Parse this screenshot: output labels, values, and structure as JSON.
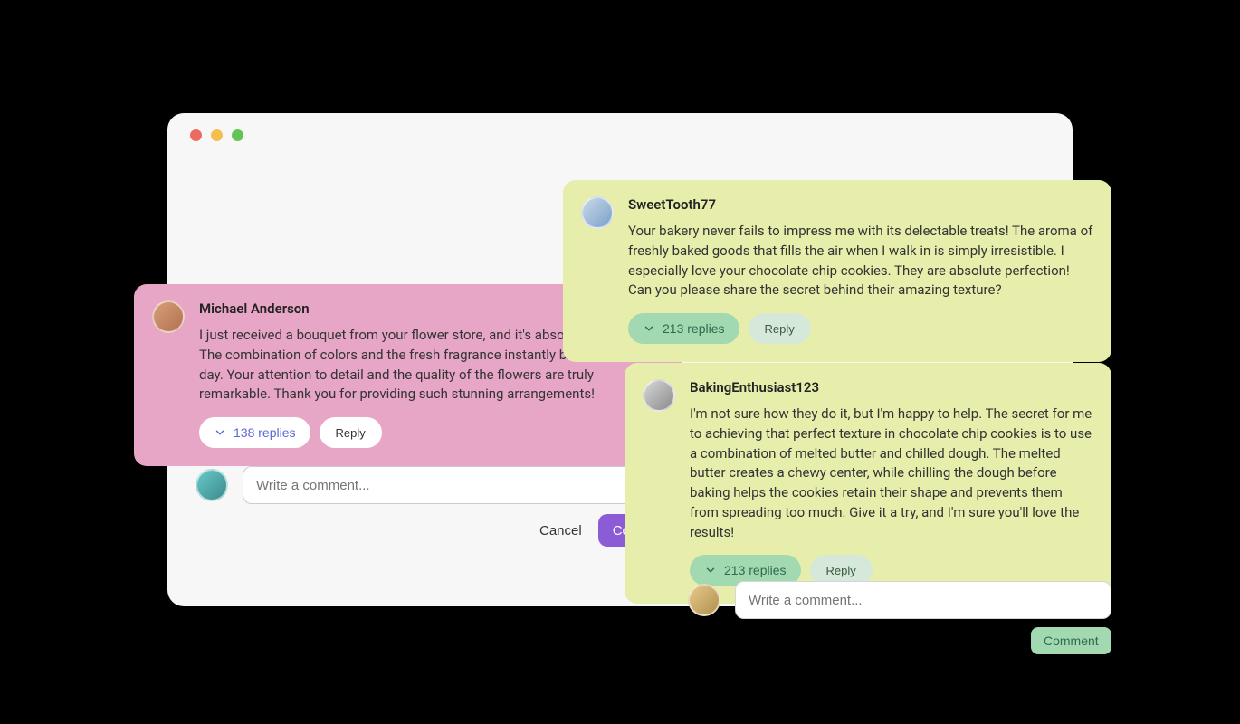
{
  "pink_card": {
    "username": "Michael Anderson",
    "body": "I just received a bouquet from your flower store, and it's absolutely stunning! The combination of colors and the fresh fragrance instantly brightened up my day. Your attention to detail and the quality of the flowers are truly remarkable. Thank you for providing such stunning arrangements!",
    "replies_label": "138 replies",
    "reply_label": "Reply"
  },
  "green_card_1": {
    "username": "SweetTooth77",
    "body": "Your bakery never fails to impress me with its delectable treats! The aroma of freshly baked goods that fills the air when I walk in is simply irresistible. I especially love your chocolate chip cookies. They are absolute perfection! Can you please share the secret behind their amazing texture?",
    "replies_label": "213 replies",
    "reply_label": "Reply"
  },
  "green_card_2": {
    "username": "BakingEnthusiast123",
    "body": "I'm not sure how they do it, but I'm happy to help. The secret for me to achieving that perfect texture in chocolate chip cookies is to use a combination of melted butter and chilled dough. The melted butter creates a chewy center, while chilling the dough before baking helps the cookies retain their shape and prevents them from spreading too much. Give it a try, and I'm sure you'll love the results!",
    "replies_label": "213 replies",
    "reply_label": "Reply"
  },
  "compose": {
    "placeholder": "Write a comment...",
    "cancel_label": "Cancel",
    "comment_label": "Comment"
  }
}
